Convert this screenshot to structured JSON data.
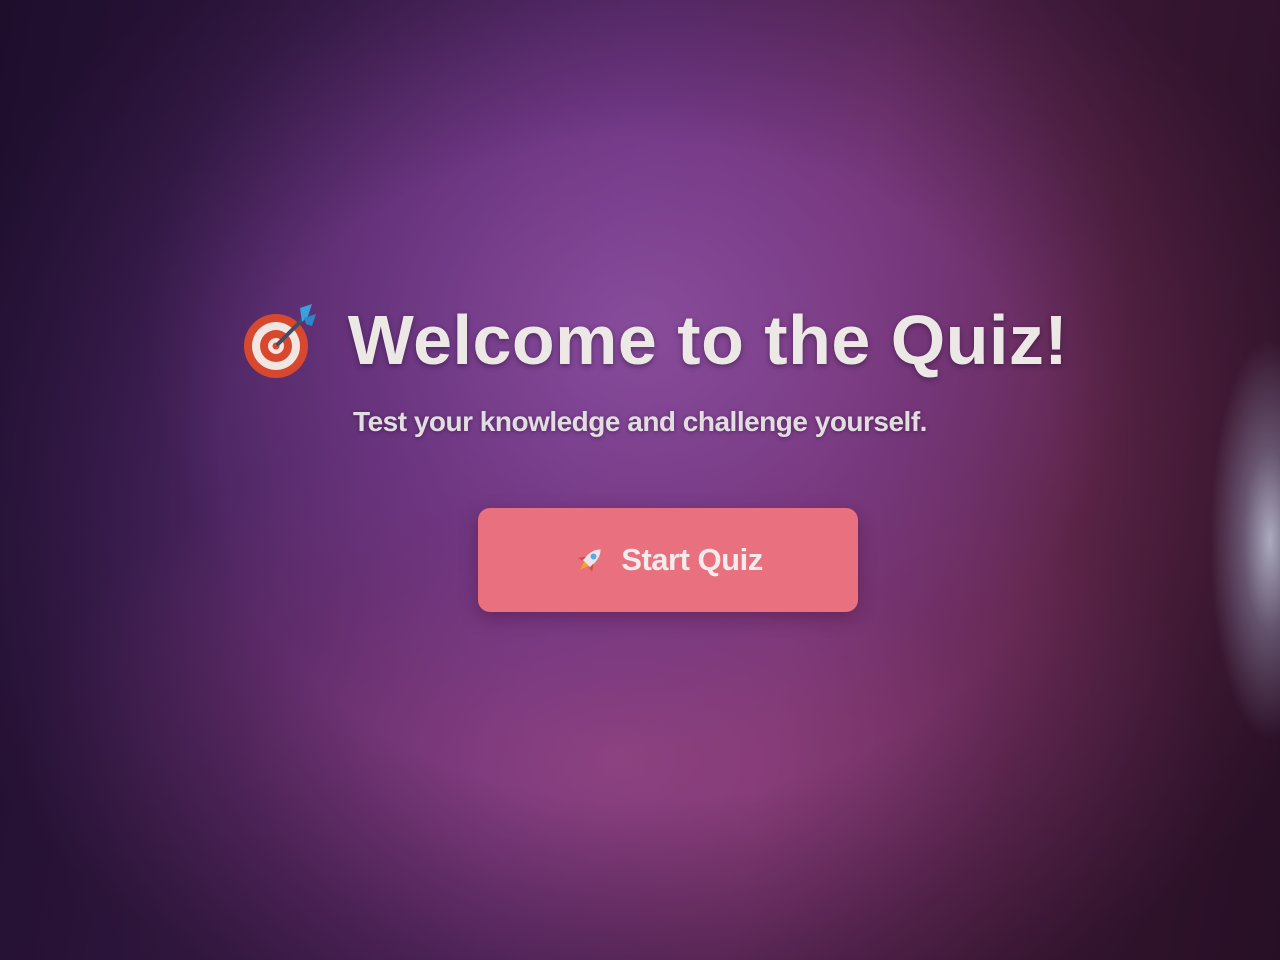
{
  "welcome": {
    "title": "Welcome to the Quiz!",
    "subtitle": "Test your knowledge and challenge yourself.",
    "icon": "target-icon"
  },
  "start_button": {
    "label": "Start Quiz",
    "icon": "rocket-icon",
    "color": "#e9707e"
  },
  "colors": {
    "background_start": "#2a1540",
    "background_mid": "#6a3380",
    "background_end": "#3e1830",
    "text": "#ece8e6"
  }
}
